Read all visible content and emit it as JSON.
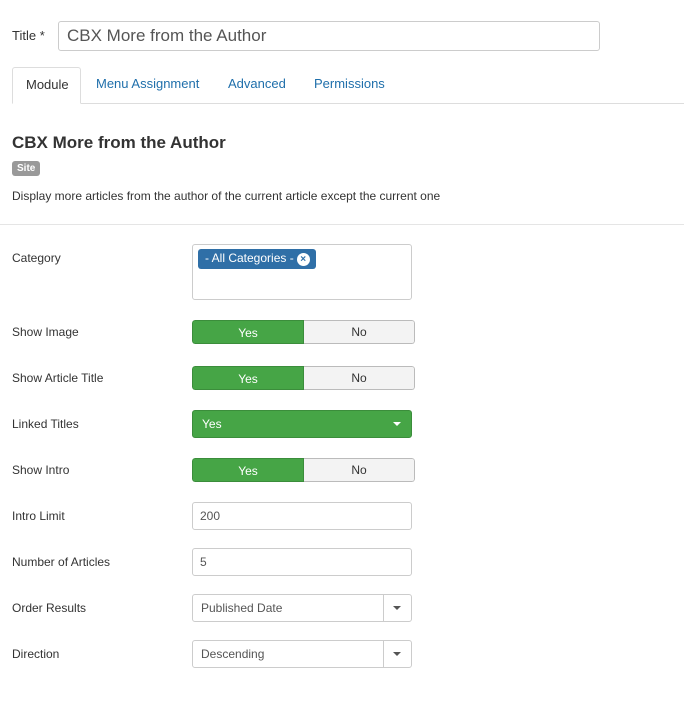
{
  "title_field": {
    "label": "Title *",
    "value": "CBX More from the Author"
  },
  "tabs": [
    {
      "label": "Module"
    },
    {
      "label": "Menu Assignment"
    },
    {
      "label": "Advanced"
    },
    {
      "label": "Permissions"
    }
  ],
  "module": {
    "heading": "CBX More from the Author",
    "badge": "Site",
    "description": "Display more articles from the author of the current article except the current one"
  },
  "fields": {
    "category": {
      "label": "Category",
      "chip": "- All Categories -",
      "chip_remove": "×"
    },
    "show_image": {
      "label": "Show Image",
      "yes": "Yes",
      "no": "No",
      "selected": "Yes"
    },
    "show_article_title": {
      "label": "Show Article Title",
      "yes": "Yes",
      "no": "No",
      "selected": "Yes"
    },
    "linked_titles": {
      "label": "Linked Titles",
      "value": "Yes"
    },
    "show_intro": {
      "label": "Show Intro",
      "yes": "Yes",
      "no": "No",
      "selected": "Yes"
    },
    "intro_limit": {
      "label": "Intro Limit",
      "value": "200"
    },
    "number_of_articles": {
      "label": "Number of Articles",
      "value": "5"
    },
    "order_results": {
      "label": "Order Results",
      "value": "Published Date"
    },
    "direction": {
      "label": "Direction",
      "value": "Descending"
    }
  },
  "colors": {
    "green": "#46a546",
    "link": "#1f6fab",
    "chip": "#2f6fa7"
  }
}
